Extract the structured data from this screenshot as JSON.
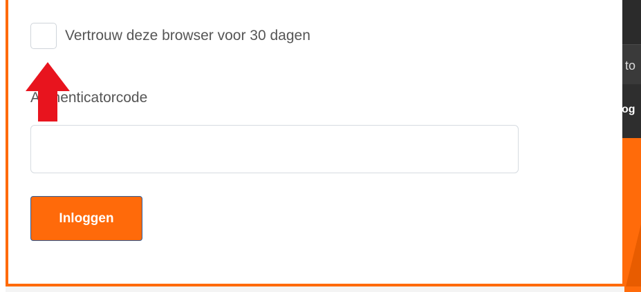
{
  "form": {
    "trust_browser_label": "Vertrouw deze browser voor 30 dagen",
    "trust_browser_checked": false,
    "code_label": "Authenticatorcode",
    "code_value": "",
    "login_button": "Inloggen"
  },
  "background": {
    "text_fragment_1": "to",
    "text_fragment_2": "og"
  },
  "annotation": {
    "arrow_color": "#e8141e",
    "arrow_direction": "up"
  },
  "colors": {
    "accent": "#ff6a00",
    "button_border": "#2d5b9a"
  }
}
